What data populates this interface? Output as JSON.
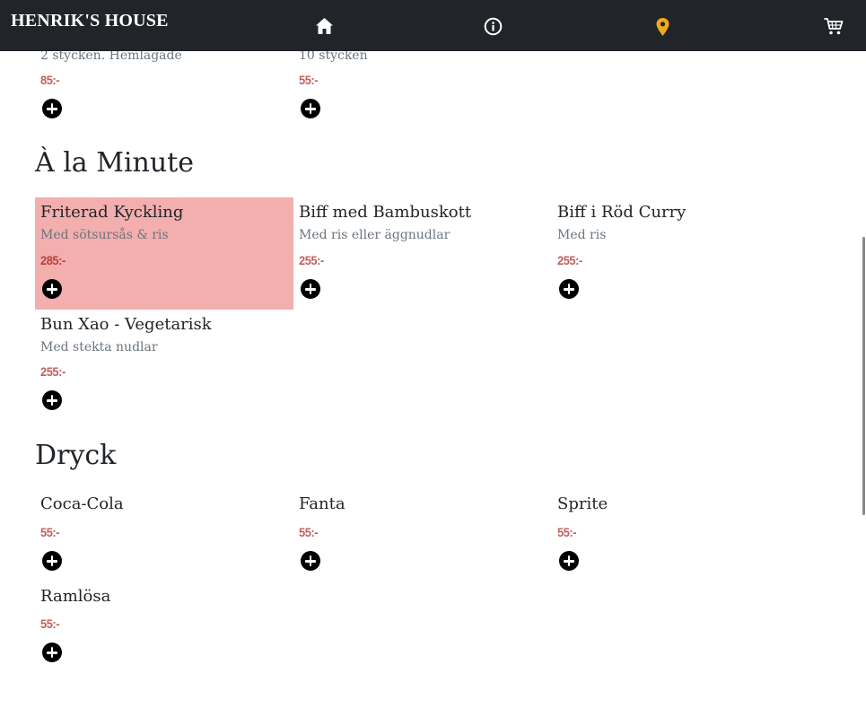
{
  "nav": {
    "brand": "HENRIK'S HOUSE",
    "icons": {
      "home": "home-icon",
      "info": "info-icon",
      "location": "map-pin-icon",
      "cart": "cart-icon"
    },
    "location_color": "#f0a81c"
  },
  "prev_section": {
    "items": [
      {
        "desc": "2 stycken. Hemlagade",
        "price": "85:-"
      },
      {
        "desc": "10 stycken",
        "price": "55:-"
      }
    ]
  },
  "alaminute": {
    "title": "À la Minute",
    "items": [
      {
        "name": "Friterad Kyckling",
        "desc": "Med sötsursås & ris",
        "price": "285:-",
        "highlighted": true
      },
      {
        "name": "Biff med Bambuskott",
        "desc": "Med ris eller äggnudlar",
        "price": "255:-"
      },
      {
        "name": "Biff i Röd Curry",
        "desc": "Med ris",
        "price": "255:-"
      },
      {
        "name": "Bun Xao - Vegetarisk",
        "desc": "Med stekta nudlar",
        "price": "255:-"
      }
    ]
  },
  "dryck": {
    "title": "Dryck",
    "items": [
      {
        "name": "Coca-Cola",
        "price": "55:-"
      },
      {
        "name": "Fanta",
        "price": "55:-"
      },
      {
        "name": "Sprite",
        "price": "55:-"
      },
      {
        "name": "Ramlösa",
        "price": "55:-"
      }
    ]
  },
  "colors": {
    "navbar": "#212529",
    "highlight": "#f3aeae",
    "price": "#c0605f"
  }
}
